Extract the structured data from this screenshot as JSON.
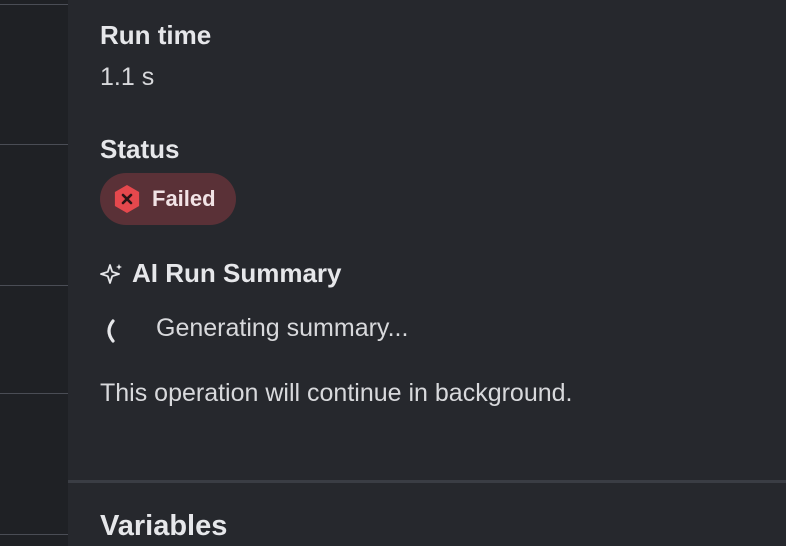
{
  "run_time": {
    "label": "Run time",
    "value": "1.1 s"
  },
  "status": {
    "label": "Status",
    "badge": {
      "text": "Failed",
      "icon": "x-hexagon-icon",
      "icon_color": "#e5484d",
      "background_color": "#5a3137"
    }
  },
  "ai_summary": {
    "title": "AI Run Summary",
    "icon": "sparkle-icon",
    "loading_text": "Generating summary...",
    "note": "This operation will continue in background."
  },
  "variables": {
    "title": "Variables"
  },
  "colors": {
    "panel_background": "#26282d",
    "page_background": "#1f2125",
    "text_primary": "#e6e7ea",
    "failed_red": "#e5484d"
  }
}
